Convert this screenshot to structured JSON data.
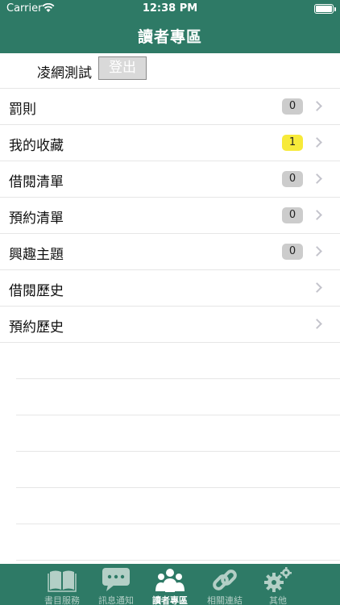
{
  "status_bar": {
    "carrier": "Carrier",
    "time": "12:38 PM"
  },
  "nav": {
    "title": "讀者專區"
  },
  "user": {
    "name": "凌網測試",
    "logout_label": "登出"
  },
  "menu": {
    "items": [
      {
        "label": "罰則",
        "badge": "0"
      },
      {
        "label": "我的收藏",
        "badge": "1",
        "highlight": true
      },
      {
        "label": "借閱清單",
        "badge": "0"
      },
      {
        "label": "預約清單",
        "badge": "0"
      },
      {
        "label": "興趣主題",
        "badge": "0"
      },
      {
        "label": "借閱歷史"
      },
      {
        "label": "預約歷史"
      }
    ]
  },
  "tabs": [
    {
      "label": "書目服務",
      "icon": "book-icon"
    },
    {
      "label": "訊息通知",
      "icon": "chat-bubble-icon"
    },
    {
      "label": "讀者專區",
      "icon": "users-icon",
      "active": true
    },
    {
      "label": "相關連結",
      "icon": "link-icon"
    },
    {
      "label": "其他",
      "icon": "gears-icon"
    }
  ],
  "colors": {
    "brand": "#2e7a66",
    "badge_default": "#cccccc",
    "badge_highlight": "#f7ea3a",
    "tab_inactive": "#b3cfc6"
  }
}
